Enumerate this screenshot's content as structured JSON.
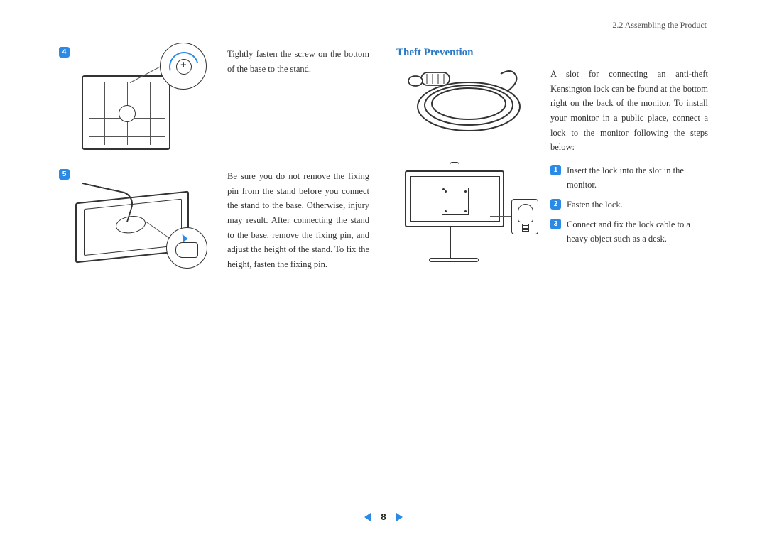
{
  "header": {
    "section": "2.2 Assembling the Product"
  },
  "steps": {
    "s4": {
      "num": "4",
      "text": "Tightly fasten the screw on the bottom of the base to the stand."
    },
    "s5": {
      "num": "5",
      "text": "Be sure you do not remove the fixing pin from the stand before you connect the stand to the base. Otherwise, injury may result. After connecting the stand to the base, remove the fixing pin, and adjust the height of the stand. To fix the height, fasten the fixing pin."
    }
  },
  "section2": {
    "heading": "Theft Prevention",
    "intro": "A slot for connecting an anti-theft Kensington lock can be found at the bottom right on the back of the monitor. To install your monitor in a public place, connect a lock to the monitor following the steps below:",
    "items": [
      {
        "n": "1",
        "t": "Insert the lock into the slot in the monitor."
      },
      {
        "n": "2",
        "t": "Fasten the lock."
      },
      {
        "n": "3",
        "t": "Connect and fix the lock cable to a heavy object such as a desk."
      }
    ]
  },
  "pager": {
    "page": "8"
  }
}
